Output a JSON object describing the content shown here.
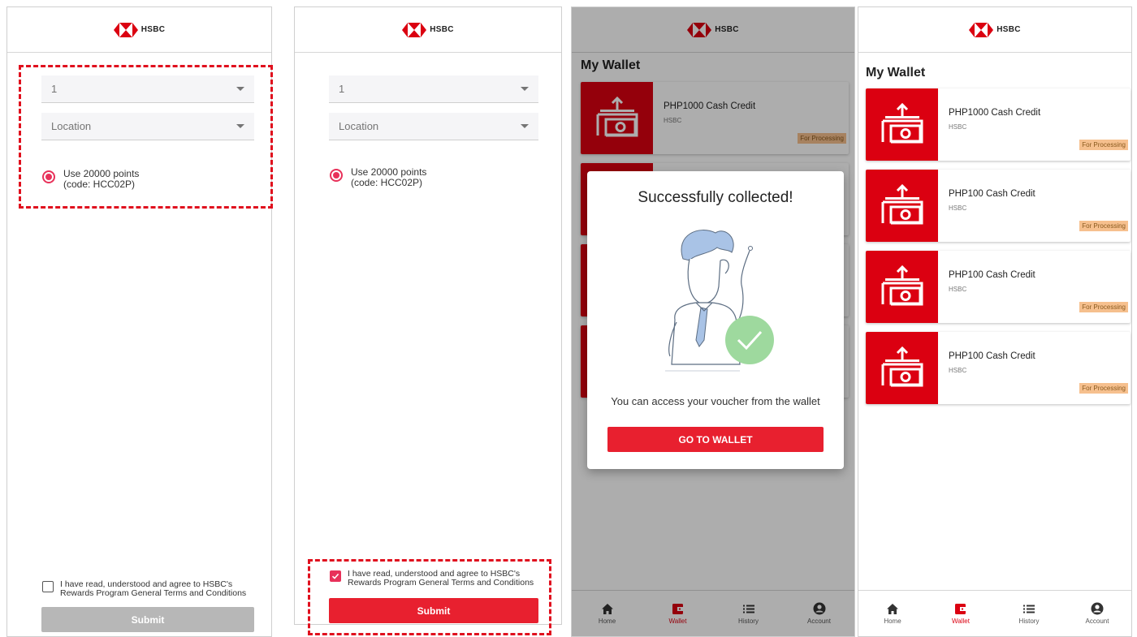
{
  "brand": {
    "name": "HSBC",
    "red": "#db0011",
    "accent": "#e8315a",
    "button_red": "#e8202f"
  },
  "screen1": {
    "quantity_value": "1",
    "location_placeholder": "Location",
    "radio_label_line1": "Use 20000 points",
    "radio_label_line2": "(code: HCC02P)",
    "radio_selected": true,
    "terms_line1": "I have read, understood and agree to HSBC's",
    "terms_line2": "Rewards Program General Terms and Conditions",
    "terms_checked": false,
    "submit_label": "Submit",
    "submit_enabled": false
  },
  "screen2": {
    "quantity_value": "1",
    "location_placeholder": "Location",
    "radio_label_line1": "Use 20000 points",
    "radio_label_line2": "(code: HCC02P)",
    "radio_selected": true,
    "terms_line1": "I have read, understood and agree to HSBC's",
    "terms_line2": "Rewards Program General Terms and Conditions",
    "terms_checked": true,
    "submit_label": "Submit",
    "submit_enabled": true
  },
  "screen3": {
    "wallet_title": "My Wallet",
    "card_title": "PHP1000 Cash Credit",
    "card_issuer": "HSBC",
    "card_status": "For Processing",
    "modal_title": "Successfully collected!",
    "modal_message": "You can access your voucher from the wallet",
    "modal_button": "GO TO WALLET"
  },
  "screen4": {
    "wallet_title": "My Wallet",
    "vouchers": [
      {
        "title": "PHP1000 Cash Credit",
        "issuer": "HSBC",
        "status": "For Processing"
      },
      {
        "title": "PHP100 Cash Credit",
        "issuer": "HSBC",
        "status": "For Processing"
      },
      {
        "title": "PHP100 Cash Credit",
        "issuer": "HSBC",
        "status": "For Processing"
      },
      {
        "title": "PHP100 Cash Credit",
        "issuer": "HSBC",
        "status": "For Processing"
      }
    ]
  },
  "nav": {
    "items": [
      {
        "label": "Home",
        "icon": "home-icon"
      },
      {
        "label": "Wallet",
        "icon": "wallet-icon"
      },
      {
        "label": "History",
        "icon": "history-icon"
      },
      {
        "label": "Account",
        "icon": "account-icon"
      }
    ],
    "active": "Wallet"
  }
}
